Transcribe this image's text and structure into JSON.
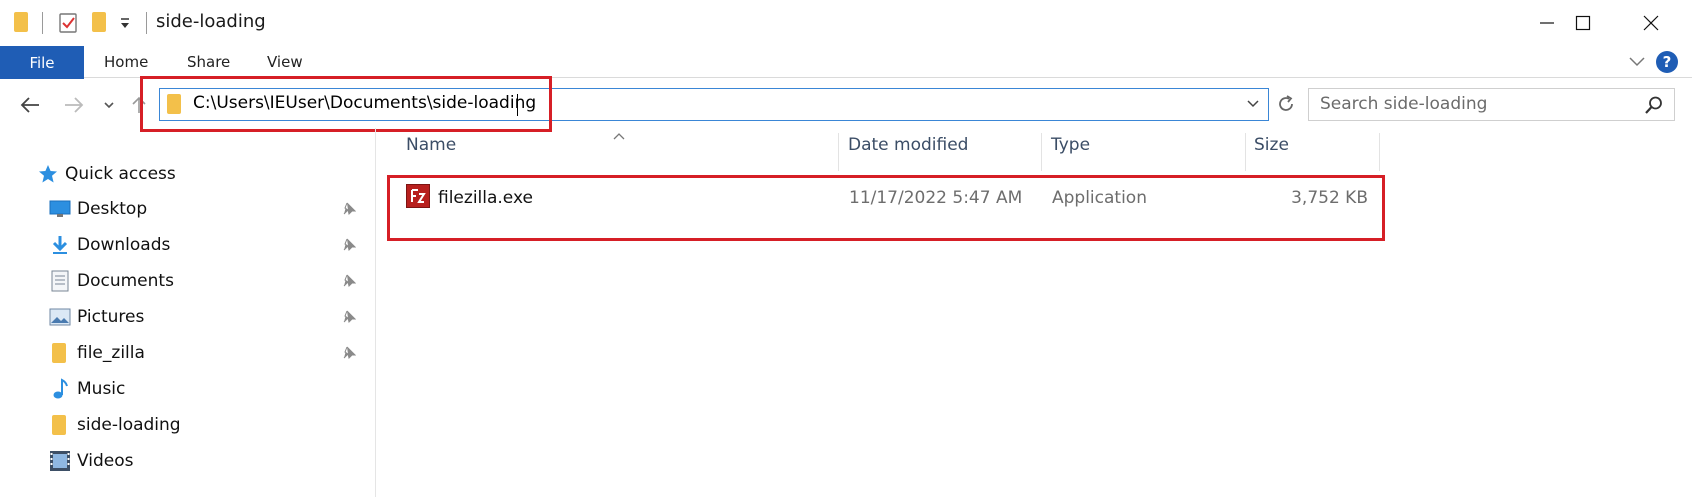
{
  "window": {
    "title": "side-loading",
    "minimize_label": "",
    "maximize_label": "",
    "close_label": ""
  },
  "ribbon": {
    "tabs": [
      "File",
      "Home",
      "Share",
      "View"
    ],
    "help_label": "?"
  },
  "address": {
    "path": "C:\\Users\\IEUser\\Documents\\side-loading"
  },
  "search": {
    "placeholder": "Search side-loading"
  },
  "navpane": {
    "quick_access": "Quick access",
    "items": [
      {
        "label": "Desktop",
        "icon": "desktop-icon",
        "pinned": true
      },
      {
        "label": "Downloads",
        "icon": "downloads-icon",
        "pinned": true
      },
      {
        "label": "Documents",
        "icon": "documents-icon",
        "pinned": true
      },
      {
        "label": "Pictures",
        "icon": "pictures-icon",
        "pinned": true
      },
      {
        "label": "file_zilla",
        "icon": "folder-icon",
        "pinned": true
      },
      {
        "label": "Music",
        "icon": "music-icon",
        "pinned": false
      },
      {
        "label": "side-loading",
        "icon": "folder-icon",
        "pinned": false
      },
      {
        "label": "Videos",
        "icon": "videos-icon",
        "pinned": false
      }
    ]
  },
  "files": {
    "columns": [
      "Name",
      "Date modified",
      "Type",
      "Size"
    ],
    "rows": [
      {
        "name": "filezilla.exe",
        "date": "11/17/2022 5:47 AM",
        "type": "Application",
        "size": "3,752 KB"
      }
    ]
  },
  "colors": {
    "accent": "#1f5db5",
    "highlight": "#d61f26",
    "folder": "#f3c04a"
  }
}
